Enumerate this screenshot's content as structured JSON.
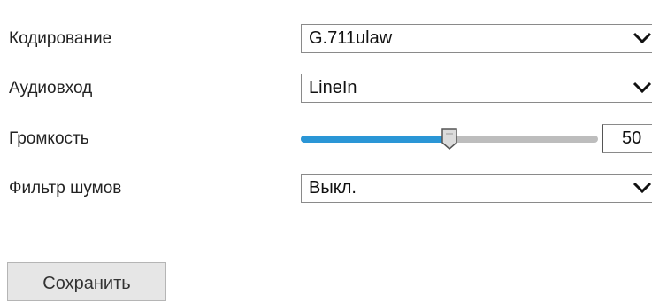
{
  "form": {
    "encoding": {
      "label": "Кодирование",
      "value": "G.711ulaw",
      "icon": "chevron-down-icon"
    },
    "audio_input": {
      "label": "Аудиовход",
      "value": "LineIn",
      "icon": "chevron-down-icon"
    },
    "volume": {
      "label": "Громкость",
      "value": "50",
      "level_fraction": 0.5
    },
    "noise_filter": {
      "label": "Фильтр шумов",
      "value": "Выкл.",
      "icon": "chevron-down-icon"
    }
  },
  "actions": {
    "save_label": "Сохранить"
  },
  "colors": {
    "slider_fill": "#2a96d6",
    "slider_track": "#bdbdbd",
    "button_bg": "#e6e6e6"
  }
}
